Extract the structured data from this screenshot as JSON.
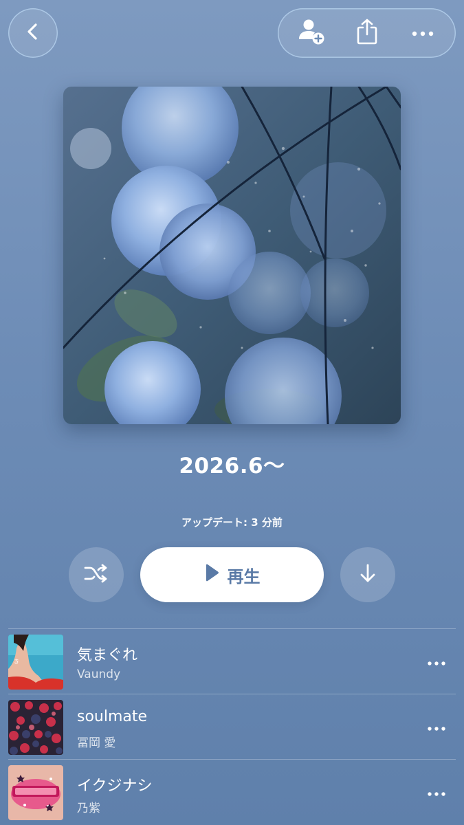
{
  "header": {
    "back_icon": "chevron-left-icon",
    "actions": [
      {
        "icon": "person-add-icon"
      },
      {
        "icon": "share-icon"
      },
      {
        "icon": "more-horizontal-icon"
      }
    ]
  },
  "playlist": {
    "title": "2026.6〜",
    "updated": "アップデート: 3 分前",
    "artwork_icon": "hydrangea-umbrella-artwork"
  },
  "controls": {
    "shuffle_icon": "shuffle-icon",
    "play_label": "再生",
    "play_icon": "play-icon",
    "download_icon": "download-arrow-icon"
  },
  "tracks": [
    {
      "title": "気まぐれ",
      "artist": "Vaundy"
    },
    {
      "title": "soulmate",
      "artist": "冨岡 愛"
    },
    {
      "title": "イクジナシ",
      "artist": "乃紫"
    }
  ],
  "colors": {
    "background_top": "#7e9ac0",
    "background_bottom": "#5f80ab",
    "play_text": "#5a7aa6"
  }
}
